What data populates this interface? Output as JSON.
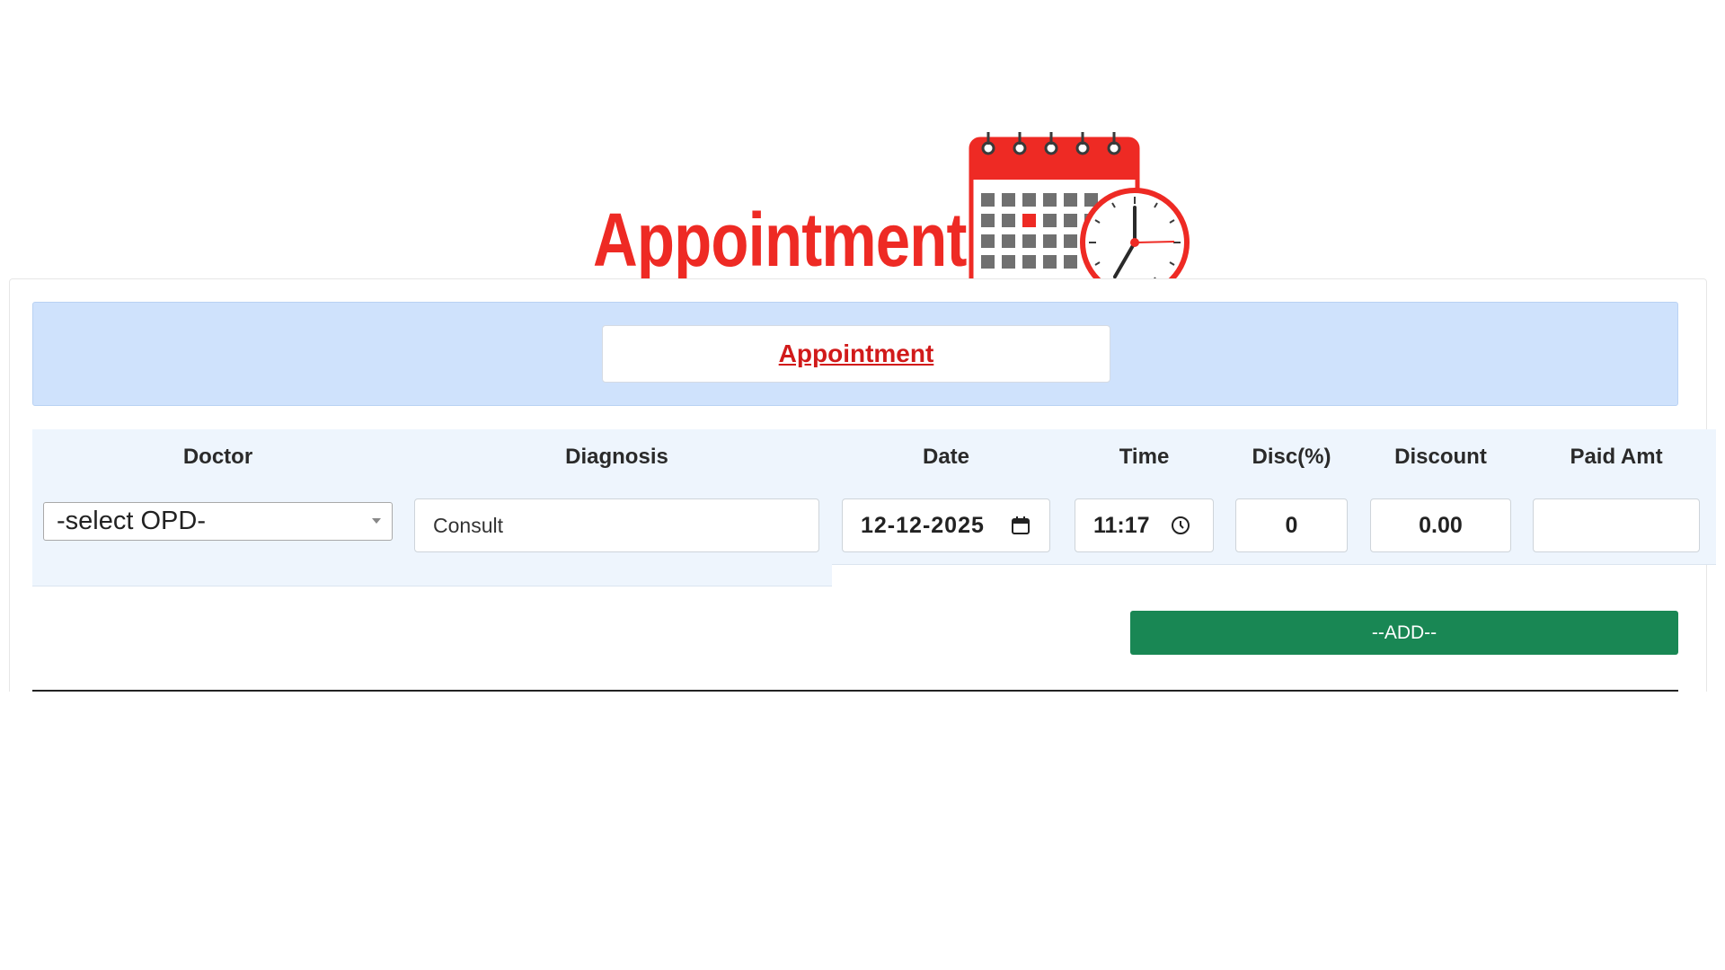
{
  "hero": {
    "title": "Appointment",
    "illustration_icon": "calendar-clock-icon",
    "accent_color": "#ee2a24"
  },
  "banner": {
    "link_label": "Appointment",
    "background_color": "#cfe2fc",
    "link_color": "#d11a1a"
  },
  "table": {
    "headers": {
      "doctor": "Doctor",
      "diagnosis": "Diagnosis",
      "date": "Date",
      "time": "Time",
      "disc_pct": "Disc(%)",
      "discount": "Discount",
      "paid_amt": "Paid Amt"
    },
    "row": {
      "doctor_selected": "-select OPD-",
      "diagnosis": "Consult",
      "date": "12-12-2025",
      "date_icon": "calendar-icon",
      "time": "11:17",
      "time_icon": "clock-icon",
      "disc_pct": "0",
      "discount": "0.00",
      "paid_amt": ""
    }
  },
  "actions": {
    "add_label": "--ADD--",
    "add_color": "#198754"
  }
}
